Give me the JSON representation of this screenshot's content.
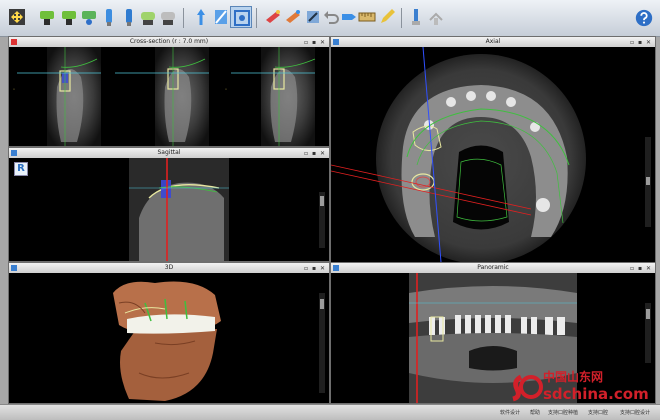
{
  "toolbar": {
    "icons": [
      "move-mode-icon",
      "green-drill-icon",
      "green-drill-icon",
      "green-drill-icon",
      "implant-icon",
      "implant-icon",
      "implant-icon",
      "implant-icon",
      "sleeve-icon",
      "sleeve-icon",
      "sleeve-icon",
      "pointer-icon",
      "cut-icon",
      "focus-icon",
      "tool-icon",
      "tool-icon",
      "tool-icon",
      "undo-icon",
      "label-icon",
      "measure-icon",
      "edit-icon",
      "drill-guide-icon",
      "export-icon",
      "help-icon"
    ]
  },
  "panes": {
    "cross_sections": {
      "title": "Cross-section (r : 7.0 mm)"
    },
    "axial": {
      "title": "Axial"
    },
    "sagittal": {
      "title": "Sagittal"
    },
    "volume_3d": {
      "title": "3D"
    },
    "panoramic": {
      "title": "Panoramic"
    }
  },
  "badge": "R",
  "statusbar": {
    "items": [
      "软件设计",
      "帮助",
      "支持口腔种植",
      "支持口腔",
      "支持口腔设计"
    ]
  },
  "watermark": {
    "brand": "sdchina.com",
    "cn": "中国山东网"
  },
  "colors": {
    "accent": "#2e6fc6",
    "implant": "#e8e8a0",
    "red_line": "#e02020",
    "green_line": "#3fbf3f",
    "blue_line": "#3050ff",
    "cyan_line": "#4fc6d8",
    "bone": "#b8704a",
    "watermark": "#d2202a"
  }
}
